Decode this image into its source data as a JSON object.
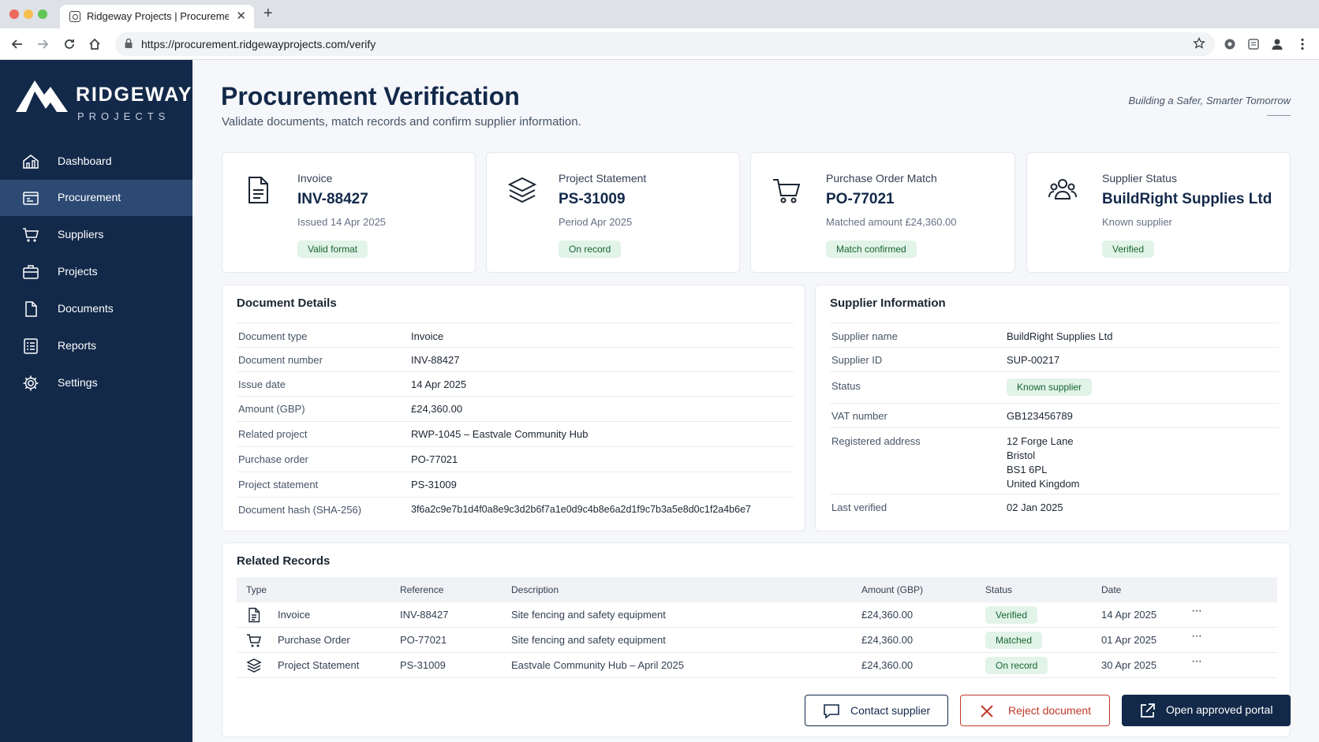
{
  "browser": {
    "tab_title": "Ridgeway Projects | Procurement",
    "url": "https://procurement.ridgewayprojects.com/verify"
  },
  "brand": {
    "name_line1": "RIDGEWAY",
    "name_line2": "PROJECTS",
    "tagline": "Building a Safer, Smarter Tomorrow",
    "colors": {
      "navy": "#13294a",
      "active_nav": "#2c4a73",
      "success_bg": "#e2f3e7",
      "success_text": "#166534",
      "danger": "#c0392b"
    }
  },
  "sidebar": {
    "items": [
      {
        "label": "Dashboard",
        "icon": "dashboard-icon"
      },
      {
        "label": "Procurement",
        "icon": "procurement-icon",
        "active": true
      },
      {
        "label": "Suppliers",
        "icon": "cart-icon"
      },
      {
        "label": "Projects",
        "icon": "briefcase-icon"
      },
      {
        "label": "Documents",
        "icon": "document-icon"
      },
      {
        "label": "Reports",
        "icon": "report-icon"
      },
      {
        "label": "Settings",
        "icon": "gear-icon"
      }
    ]
  },
  "page": {
    "title": "Procurement Verification",
    "subtitle": "Validate documents, match records and confirm supplier information."
  },
  "summary_cards": [
    {
      "label": "Invoice",
      "value": "INV-88427",
      "meta": "Issued 14 Apr 2025",
      "badge": "Valid format",
      "icon": "invoice-icon"
    },
    {
      "label": "Project Statement",
      "value": "PS-31009",
      "meta": "Period Apr 2025",
      "badge": "On record",
      "icon": "layers-icon"
    },
    {
      "label": "Purchase Order Match",
      "value": "PO-77021",
      "meta": "Matched amount £24,360.00",
      "badge": "Match confirmed",
      "icon": "cart-icon"
    },
    {
      "label": "Supplier Status",
      "value": "BuildRight Supplies Ltd",
      "meta": "Known supplier",
      "badge": "Verified",
      "icon": "people-icon"
    }
  ],
  "document_details": {
    "title": "Document Details",
    "rows": [
      {
        "key": "Document type",
        "value": "Invoice"
      },
      {
        "key": "Document number",
        "value": "INV-88427"
      },
      {
        "key": "Issue date",
        "value": "14 Apr 2025"
      },
      {
        "key": "Amount (GBP)",
        "value": "£24,360.00"
      },
      {
        "key": "Related project",
        "value": "RWP-1045 – Eastvale Community Hub"
      },
      {
        "key": "Purchase order",
        "value": "PO-77021"
      },
      {
        "key": "Project statement",
        "value": "PS-31009"
      },
      {
        "key": "Document hash (SHA-256)",
        "value": "3f6a2c9e7b1d4f0a8e9c3d2b6f7a1e0d9c4b8e6a2d1f9c7b3a5e8d0c1f2a4b6e7"
      }
    ]
  },
  "supplier_info": {
    "title": "Supplier Information",
    "name_label": "Supplier name",
    "name": "BuildRight Supplies Ltd",
    "id_label": "Supplier ID",
    "id": "SUP-00217",
    "status_label": "Status",
    "status": "Known supplier",
    "vat_label": "VAT number",
    "vat": "GB123456789",
    "address_label": "Registered address",
    "address": [
      "12 Forge Lane",
      "Bristol",
      "BS1 6PL",
      "United Kingdom"
    ],
    "last_verified_label": "Last verified",
    "last_verified": "02 Jan 2025"
  },
  "related_records": {
    "title": "Related Records",
    "columns": [
      "Type",
      "Reference",
      "Description",
      "Amount (GBP)",
      "Status",
      "Date"
    ],
    "rows": [
      {
        "type": "Invoice",
        "icon": "invoice-icon",
        "reference": "INV-88427",
        "description": "Site fencing and safety equipment",
        "amount": "£24,360.00",
        "status": "Verified",
        "date": "14 Apr 2025"
      },
      {
        "type": "Purchase Order",
        "icon": "cart-icon",
        "reference": "PO-77021",
        "description": "Site fencing and safety equipment",
        "amount": "£24,360.00",
        "status": "Matched",
        "date": "01 Apr 2025"
      },
      {
        "type": "Project Statement",
        "icon": "layers-icon",
        "reference": "PS-31009",
        "description": "Eastvale Community Hub – April 2025",
        "amount": "£24,360.00",
        "status": "On record",
        "date": "30 Apr 2025"
      }
    ],
    "more_label": "···"
  },
  "actions": {
    "contact": "Contact supplier",
    "reject": "Reject document",
    "open_portal": "Open approved portal"
  }
}
